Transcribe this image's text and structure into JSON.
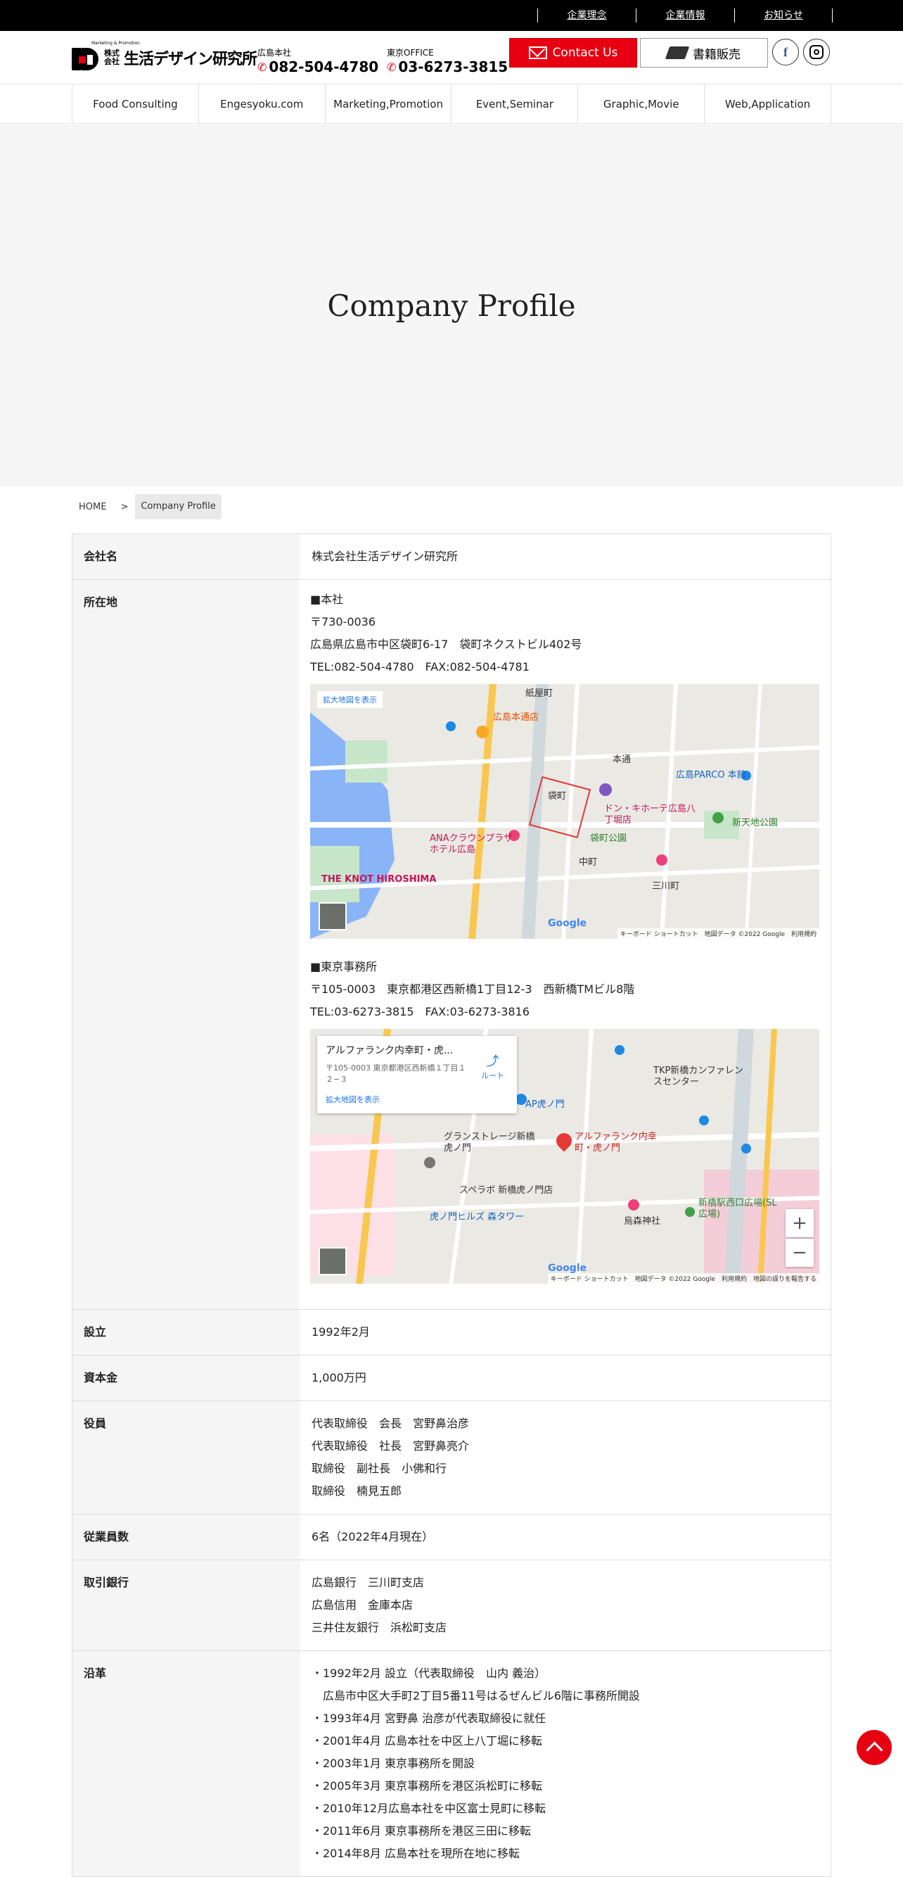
{
  "topbar": {
    "links": [
      "企業理念",
      "企業情報",
      "お知らせ"
    ]
  },
  "header": {
    "logo": {
      "tagline": "Marketing & Promotion",
      "corp": "株式会社",
      "name": "生活デザイン研究所"
    },
    "tel_hiroshima": {
      "label": "広島本社",
      "number": "082-504-4780"
    },
    "tel_tokyo": {
      "label": "東京OFFICE",
      "number": "03-6273-3815"
    },
    "contact_label": "Contact Us",
    "books_label": "書籍販売",
    "facebook": "f"
  },
  "nav": [
    "Food Consulting",
    "Engesyoku.com",
    "Marketing,Promotion",
    "Event,Seminar",
    "Graphic,Movie",
    "Web,Application"
  ],
  "hero": {
    "title": "Company Profile"
  },
  "breadcrumb": {
    "home": "HOME",
    "sep": ">",
    "current": "Company Profile"
  },
  "profile": {
    "name": {
      "label": "会社名",
      "value": "株式会社生活デザイン研究所"
    },
    "address": {
      "label": "所在地",
      "hq": [
        "■本社",
        "〒730-0036",
        "広島県広島市中区袋町6-17　袋町ネクストビル402号",
        "TEL:082-504-4780　FAX:082-504-4781"
      ],
      "tokyo": [
        "■東京事務所",
        "〒105-0003　東京都港区西新橋1丁目12-3　西新橋TMビル8階",
        "TEL:03-6273-3815　FAX:03-6273-3816"
      ]
    },
    "founded": {
      "label": "設立",
      "value": "1992年2月"
    },
    "capital": {
      "label": "資本金",
      "value": "1,000万円"
    },
    "officers": {
      "label": "役員",
      "values": [
        "代表取締役　会長　宮野鼻治彦",
        "代表取締役　社長　宮野鼻亮介",
        "取締役　副社長　小佛和行",
        "取締役　楠見五郎"
      ]
    },
    "employees": {
      "label": "従業員数",
      "value": "6名（2022年4月現在）"
    },
    "banks": {
      "label": "取引銀行",
      "values": [
        "広島銀行　三川町支店",
        "広島信用　金庫本店",
        "三井住友銀行　浜松町支店"
      ]
    },
    "history": {
      "label": "沿革",
      "values": [
        "・1992年2月 設立（代表取締役　山内 義治）",
        "　広島市中区大手町2丁目5番11号はるぜんビル6階に事務所開設",
        "・1993年4月 宮野鼻 治彦が代表取締役に就任",
        "・2001年4月 広島本社を中区上八丁堀に移転",
        "・2003年1月 東京事務所を開設",
        "・2005年3月 東京事務所を港区浜松町に移転",
        "・2010年12月広島本社を中区富士見町に移転",
        "・2011年6月 東京事務所を港区三田に移転",
        "・2014年8月 広島本社を現所在地に移転"
      ]
    }
  },
  "map1": {
    "expand": "拡大地図を表示",
    "labels": [
      "紙屋町",
      "広島本通店",
      "本通",
      "袋町",
      "ドン・キホーテ広島八丁堀店",
      "広島PARCO 本館",
      "袋町公園",
      "中町",
      "三川町",
      "THE KNOT HIROSHIMA",
      "ANAクラウンプラザホテル広島",
      "新天地公園"
    ],
    "google": "Google",
    "footer": "キーボード ショートカット　地図データ ©2022 Google　利用規約"
  },
  "map2": {
    "info_title": "アルファランク内幸町・虎...",
    "info_address": "〒105-0003 東京都港区西新橋１丁目１２−３",
    "info_route": "ルート",
    "expand": "拡大地図を表示",
    "labels": [
      "AP虎ノ門",
      "グランストレージ新橋虎ノ門",
      "アルファランク内幸町・虎ノ門",
      "スペラボ 新橋虎ノ門店",
      "虎ノ門ヒルズ 森タワー",
      "新橋駅西口広場(SL広場)",
      "烏森神社",
      "TKP新橋カンファレンスセンター"
    ],
    "zoom_in": "+",
    "zoom_out": "−",
    "google": "Google",
    "footer": "キーボード ショートカット　地図データ ©2022 Google　利用規約　地図の誤りを報告する"
  }
}
